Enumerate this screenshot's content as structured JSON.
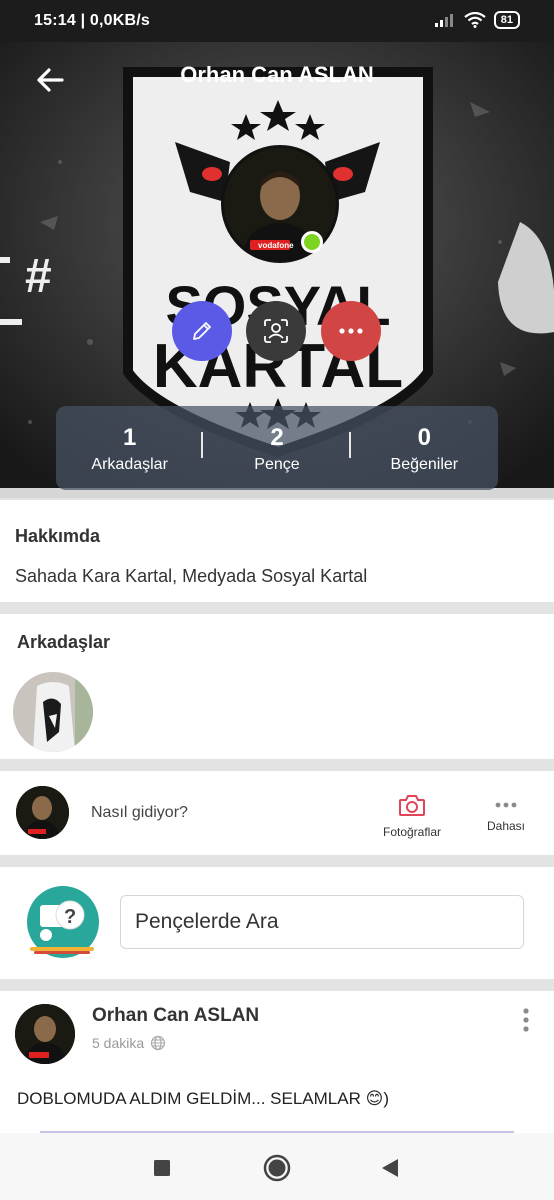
{
  "status_bar": {
    "time": "15:14 | 0,0KB/s",
    "battery": "81",
    "icons": [
      "signal-icon",
      "wifi-icon",
      "battery-icon"
    ]
  },
  "header": {
    "title": "Orhan Can ASLAN",
    "back_icon": "back-arrow-icon"
  },
  "cover": {
    "watermark_text": "SOSYAL KARTAL",
    "action_buttons": [
      {
        "icon": "pencil-icon",
        "color": "#5b5ae6"
      },
      {
        "icon": "face-scan-icon",
        "color": "#3a3a3a"
      },
      {
        "icon": "more-dots-icon",
        "color": "#d24545"
      }
    ],
    "online_color": "#7ed321"
  },
  "stats": [
    {
      "value": "1",
      "label": "Arkadaşlar"
    },
    {
      "value": "2",
      "label": "Pençe"
    },
    {
      "value": "0",
      "label": "Beğeniler"
    }
  ],
  "about": {
    "title": "Hakkımda",
    "text": "Sahada Kara Kartal, Medyada Sosyal Kartal"
  },
  "friends": {
    "title": "Arkadaşlar"
  },
  "composer": {
    "prompt": "Nasıl gidiyor?",
    "photos_label": "Fotoğraflar",
    "more_label": "Dahası"
  },
  "search": {
    "placeholder": "Pençelerde Ara"
  },
  "post": {
    "author": "Orhan Can ASLAN",
    "time": "5 dakika",
    "text": "DOBLOMUDA ALDIM GELDİM... SELAMLAR 😊)"
  },
  "nav": {
    "icons": [
      "recent-apps-icon",
      "home-icon",
      "back-icon"
    ]
  }
}
